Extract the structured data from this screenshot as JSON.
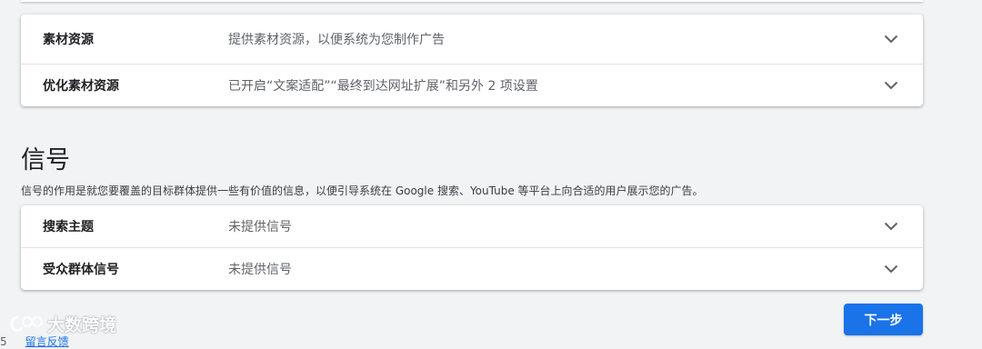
{
  "asset_section": {
    "rows": [
      {
        "label": "素材资源",
        "value": "提供素材资源，以便系统为您制作广告",
        "icon": "chevron-down-icon"
      },
      {
        "label": "优化素材资源",
        "value": "已开启“文案适配”“最终到达网址扩展”和另外 2 项设置",
        "icon": "chevron-down-icon"
      }
    ]
  },
  "signals_section": {
    "title": "信号",
    "description": "信号的作用是就您要覆盖的目标群体提供一些有价值的信息，以便引导系统在 Google 搜索、YouTube 等平台上向合适的用户展示您的广告。",
    "rows": [
      {
        "label": "搜索主题",
        "value": "未提供信号",
        "icon": "chevron-down-icon"
      },
      {
        "label": "受众群体信号",
        "value": "未提供信号",
        "icon": "chevron-down-icon"
      }
    ]
  },
  "footer": {
    "next_button": "下一步",
    "feedback_prefix": "5",
    "feedback_link": "留言反馈"
  },
  "watermark": {
    "text": "大数跨境"
  },
  "colors": {
    "background": "#f1f3f4",
    "card": "#ffffff",
    "primary_button": "#1a73e8",
    "label_text": "#202124",
    "value_text": "#5f6368"
  }
}
